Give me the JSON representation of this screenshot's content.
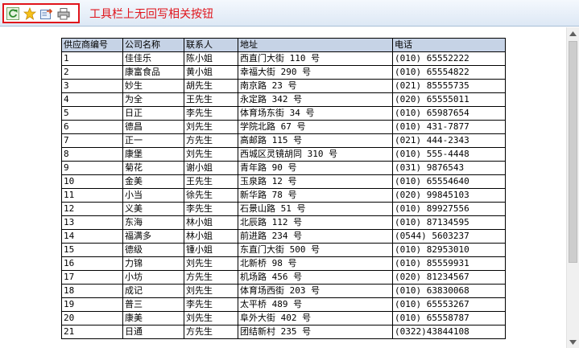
{
  "toolbar": {
    "buttons": [
      {
        "name": "refresh",
        "icon": "refresh-icon"
      },
      {
        "name": "favorite",
        "icon": "star-icon"
      },
      {
        "name": "export",
        "icon": "export-icon"
      },
      {
        "name": "print",
        "icon": "print-icon"
      }
    ],
    "note": "工具栏上无回写相关按钮",
    "note_color": "#e0141b",
    "header_bg": "#c6d3e6"
  },
  "table": {
    "headers": [
      "供应商编号",
      "公司名称",
      "联系人",
      "地址",
      "电话"
    ],
    "rows": [
      [
        "1",
        "佳佳乐",
        "陈小姐",
        "西直门大街 110 号",
        "(010) 65552222"
      ],
      [
        "2",
        "康富食品",
        "黄小姐",
        "幸福大街 290 号",
        "(010) 65554822"
      ],
      [
        "3",
        "妙生",
        "胡先生",
        "南京路 23 号",
        "(021) 85555735"
      ],
      [
        "4",
        "为全",
        "王先生",
        "永定路 342 号",
        "(020) 65555011"
      ],
      [
        "5",
        "日正",
        "李先生",
        "体育场东街 34 号",
        "(010) 65987654"
      ],
      [
        "6",
        "德昌",
        "刘先生",
        "学院北路 67 号",
        "(010) 431-7877"
      ],
      [
        "7",
        "正一",
        "方先生",
        "高邮路 115 号",
        "(021) 444-2343"
      ],
      [
        "8",
        "康堡",
        "刘先生",
        "西城区灵镜胡同 310 号",
        "(010) 555-4448"
      ],
      [
        "9",
        "菊花",
        "谢小姐",
        "青年路 90 号",
        "(031) 9876543"
      ],
      [
        "10",
        "金美",
        "王先生",
        "玉泉路 12 号",
        "(010) 65554640"
      ],
      [
        "11",
        "小当",
        "徐先生",
        "新华路 78 号",
        "(020) 99845103"
      ],
      [
        "12",
        "义美",
        "李先生",
        "石景山路 51 号",
        "(010) 89927556"
      ],
      [
        "13",
        "东海",
        "林小姐",
        "北辰路 112 号",
        "(010) 87134595"
      ],
      [
        "14",
        "福满多",
        "林小姐",
        "前进路 234 号",
        "(0544) 5603237"
      ],
      [
        "15",
        "德级",
        "锺小姐",
        "东直门大街 500 号",
        "(010) 82953010"
      ],
      [
        "16",
        "力锦",
        "刘先生",
        "北新桥 98 号",
        "(010) 85559931"
      ],
      [
        "17",
        "小坊",
        "方先生",
        "机场路 456 号",
        "(020) 81234567"
      ],
      [
        "18",
        "成记",
        "刘先生",
        "体育场西街 203 号",
        "(010) 63830068"
      ],
      [
        "19",
        "普三",
        "李先生",
        "太平桥 489 号",
        "(010) 65553267"
      ],
      [
        "20",
        "康美",
        "刘先生",
        "阜外大街 402 号",
        "(010) 65558787"
      ],
      [
        "21",
        "日通",
        "方先生",
        "团结新村 235 号",
        "(0322)43844108"
      ]
    ]
  },
  "scrollbar": {
    "up_icon": "arrow-up-icon",
    "down_icon": "arrow-down-icon"
  }
}
